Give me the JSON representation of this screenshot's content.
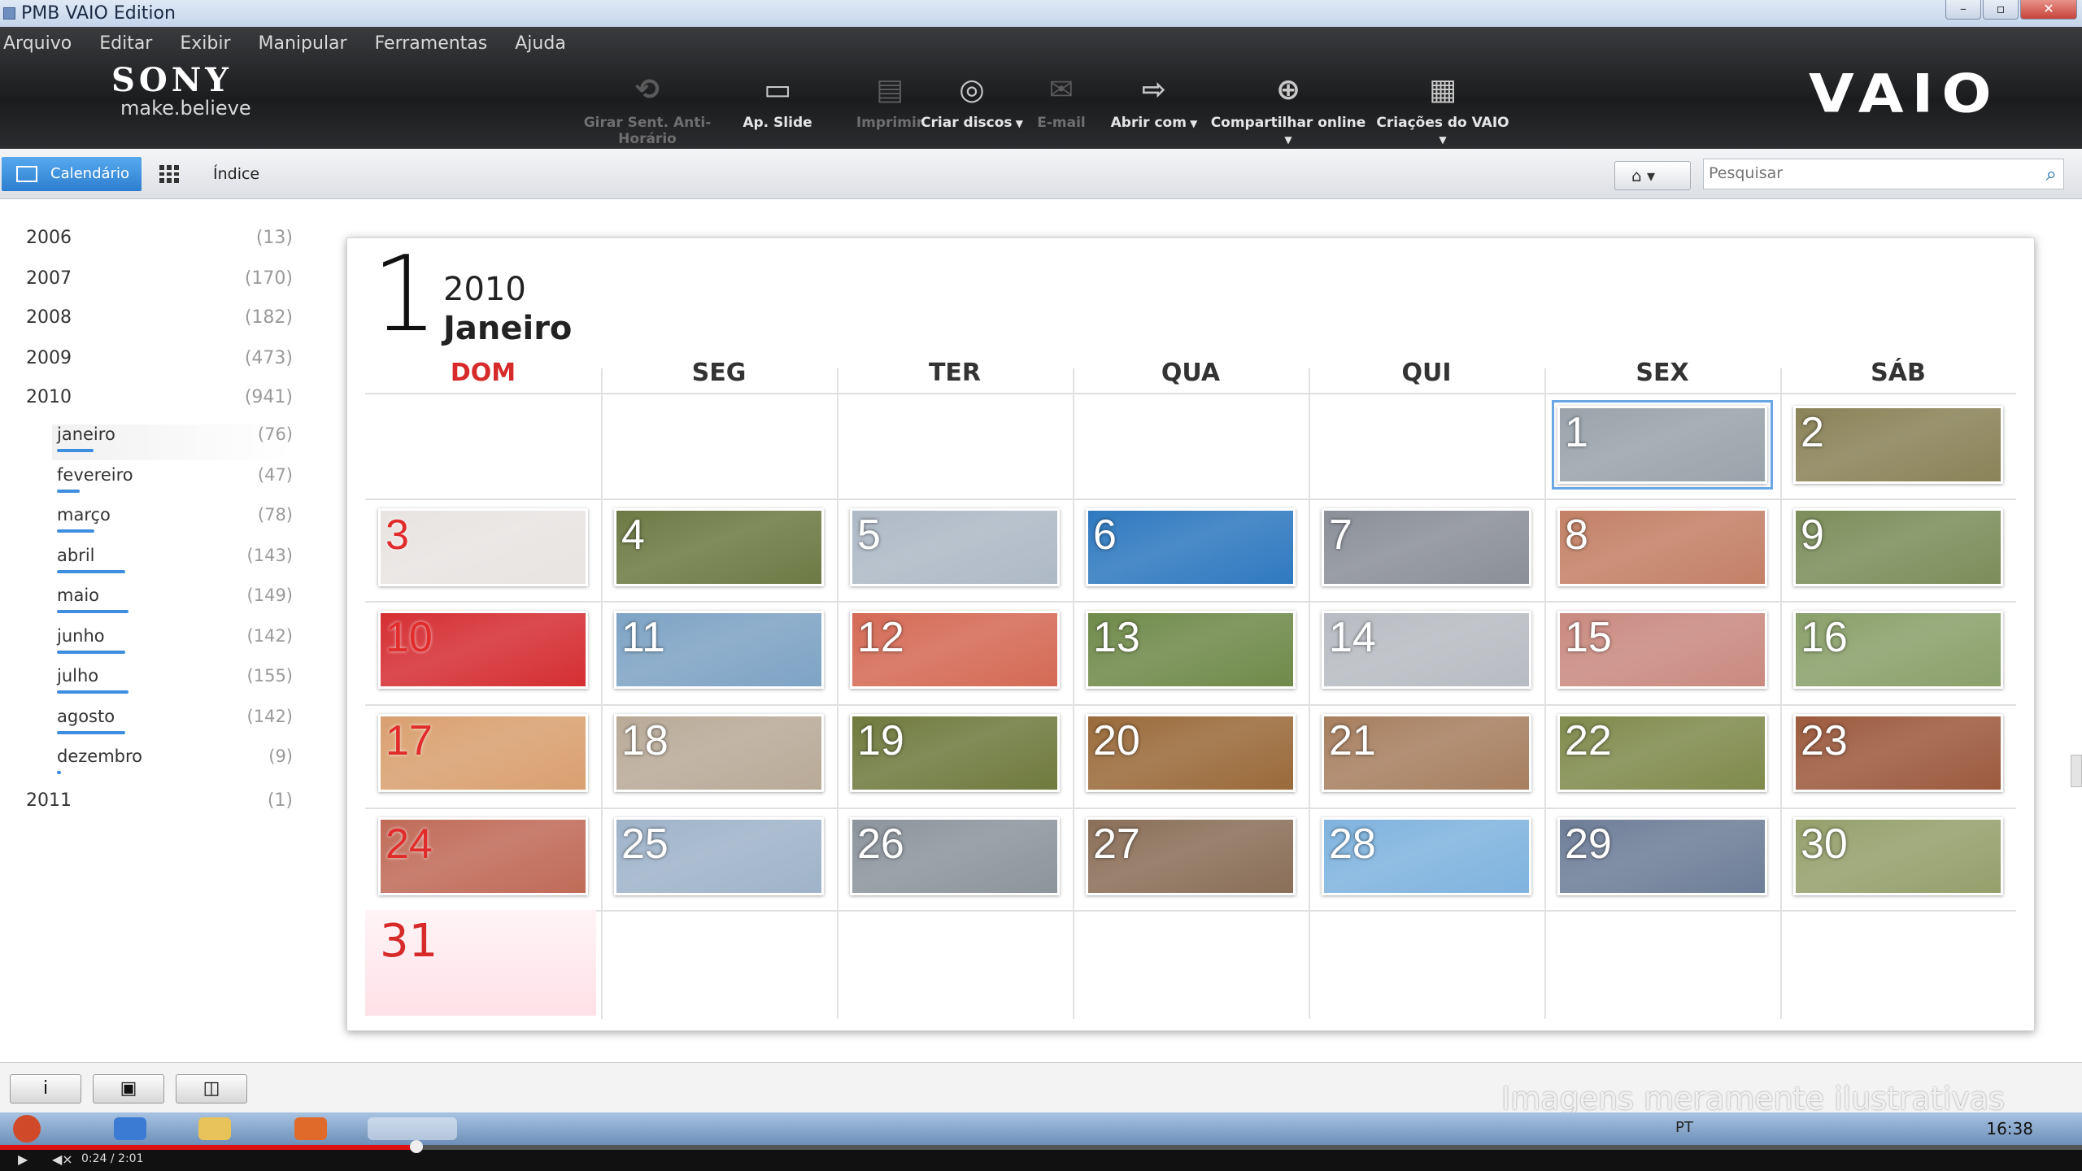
{
  "window": {
    "title": "PMB VAIO Edition",
    "controls": [
      "–",
      "▫",
      "✕"
    ]
  },
  "menu": [
    "Arquivo",
    "Editar",
    "Exibir",
    "Manipular",
    "Ferramentas",
    "Ajuda"
  ],
  "brand": {
    "sony": "SONY",
    "tagline": "make.believe",
    "vaio": "VAIO"
  },
  "toolbar": [
    {
      "label": "Girar Sent. Anti-Horário",
      "icon": "rotate-icon",
      "enabled": false,
      "dropdown": false
    },
    {
      "label": "Ap. Slide",
      "icon": "slideshow-icon",
      "enabled": true,
      "dropdown": false
    },
    {
      "label": "Imprimir",
      "icon": "print-icon",
      "enabled": false,
      "dropdown": false
    },
    {
      "label": "Criar discos",
      "icon": "disc-icon",
      "enabled": true,
      "dropdown": true
    },
    {
      "label": "E-mail",
      "icon": "email-icon",
      "enabled": false,
      "dropdown": false
    },
    {
      "label": "Abrir com",
      "icon": "open-with-icon",
      "enabled": true,
      "dropdown": true
    },
    {
      "label": "Compartilhar online",
      "icon": "globe-icon",
      "enabled": true,
      "dropdown": true
    },
    {
      "label": "Criações do VAIO",
      "icon": "clapper-icon",
      "enabled": true,
      "dropdown": true
    }
  ],
  "viewbar": {
    "calendar_tab": "Calendário",
    "index_tab": "Índice",
    "search_placeholder": "Pesquisar"
  },
  "years": [
    {
      "year": "2006",
      "count": "(13)"
    },
    {
      "year": "2007",
      "count": "(170)"
    },
    {
      "year": "2008",
      "count": "(182)"
    },
    {
      "year": "2009",
      "count": "(473)"
    },
    {
      "year": "2010",
      "count": "(941)"
    },
    {
      "year": "2011",
      "count": "(1)"
    }
  ],
  "months_2010": [
    {
      "name": "janeiro",
      "count": "(76)",
      "fraction": 0.51,
      "selected": true
    },
    {
      "name": "fevereiro",
      "count": "(47)",
      "fraction": 0.32,
      "selected": false
    },
    {
      "name": "março",
      "count": "(78)",
      "fraction": 0.52,
      "selected": false
    },
    {
      "name": "abril",
      "count": "(143)",
      "fraction": 0.96,
      "selected": false
    },
    {
      "name": "maio",
      "count": "(149)",
      "fraction": 1.0,
      "selected": false
    },
    {
      "name": "junho",
      "count": "(142)",
      "fraction": 0.95,
      "selected": false
    },
    {
      "name": "julho",
      "count": "(155)",
      "fraction": 1.0,
      "selected": false
    },
    {
      "name": "agosto",
      "count": "(142)",
      "fraction": 0.95,
      "selected": false
    },
    {
      "name": "dezembro",
      "count": "(9)",
      "fraction": 0.06,
      "selected": false
    }
  ],
  "calendar": {
    "big_day": "1",
    "year": "2010",
    "month": "Janeiro",
    "weekdays": [
      "DOM",
      "SEG",
      "TER",
      "QUA",
      "QUI",
      "SEX",
      "SÁB"
    ],
    "photo_days": [
      "1",
      "2",
      "3",
      "4",
      "5",
      "6",
      "7",
      "8",
      "9",
      "10",
      "11",
      "12",
      "13",
      "14",
      "15",
      "16",
      "17",
      "18",
      "19",
      "20",
      "21",
      "22",
      "23",
      "24",
      "25",
      "26",
      "27",
      "28",
      "29",
      "30"
    ],
    "last_day": "31",
    "selected_day": "1",
    "thumb_colors": [
      "#9aa3ab",
      "#8a8258",
      "#e8e4e2",
      "#6d7a44",
      "#aeb9c6",
      "#2f79c0",
      "#8b8f98",
      "#c38066",
      "#7c8d5a",
      "#d52f33",
      "#7ea3c4",
      "#d46a55",
      "#6f8a4a",
      "#b8bcc2",
      "#c98a80",
      "#8aa06a",
      "#d9a070",
      "#b9aa98",
      "#6f7a3e",
      "#9a6a3a",
      "#a77f60",
      "#7f8a4c",
      "#9c5a3e",
      "#c06b58",
      "#9fb3c9",
      "#8d949c",
      "#8a6f58",
      "#7fb3de",
      "#6e7e98",
      "#95a06c"
    ]
  },
  "bottom": {
    "buttons": [
      "i",
      "▣",
      "◫"
    ],
    "watermark": "Imagens meramente ilustrativas"
  },
  "taskbar": {
    "clock": "16:38",
    "lang": "PT"
  },
  "player": {
    "time": "0:24 / 2:01",
    "progress": 0.2
  }
}
